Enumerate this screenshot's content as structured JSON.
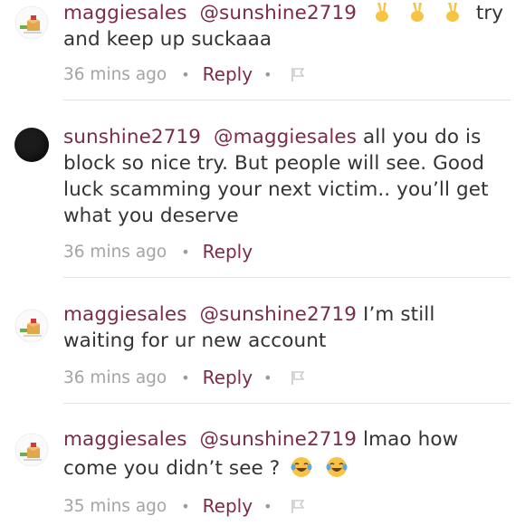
{
  "comments": [
    {
      "user": "maggiesales",
      "mention": "@sunshine2719",
      "line1_text": "try",
      "line2_text": "and keep up suckaaa",
      "time": "36 mins ago",
      "reply_label": "Reply",
      "avatar": "box-logo-icon",
      "has_flag": true,
      "emoji": "victory-hand-icon"
    },
    {
      "user": "sunshine2719",
      "mention": "@maggiesales",
      "line1_text": "all you do is",
      "line2_text": "block so nice try. But people will see. Good",
      "line3_text": "luck scamming your next victim.. you’ll get",
      "line4_text": "what you deserve",
      "time": "36 mins ago",
      "reply_label": "Reply",
      "avatar": "dark-avatar",
      "has_flag": false
    },
    {
      "user": "maggiesales",
      "mention": "@sunshine2719",
      "line1_text": "I’m still",
      "line2_text": "waiting for ur new account",
      "time": "36 mins ago",
      "reply_label": "Reply",
      "avatar": "box-logo-icon",
      "has_flag": true
    },
    {
      "user": "maggiesales",
      "mention": "@sunshine2719",
      "line1_text": "lmao how",
      "line2_text": "come you didn’t see ?",
      "time": "35 mins ago",
      "reply_label": "Reply",
      "avatar": "box-logo-icon",
      "has_flag": true,
      "emoji": "tears-of-joy-icon"
    }
  ],
  "colors": {
    "username": "#7a2d45",
    "body_text": "#333333",
    "meta_text": "#a4a4a4",
    "divider": "#e2e2e2"
  }
}
